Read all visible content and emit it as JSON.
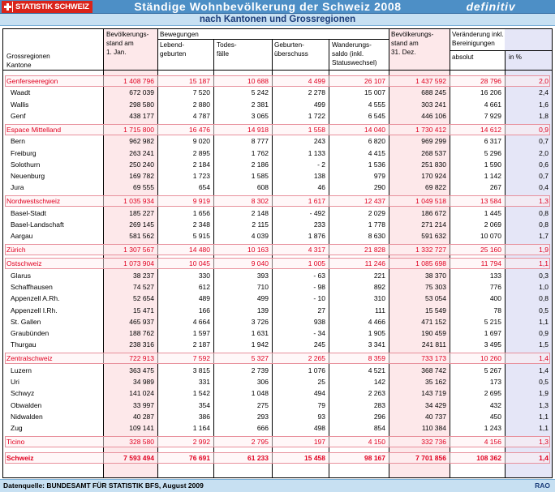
{
  "header": {
    "logo_text": "STATISTIK SCHWEIZ",
    "title": "Ständige Wohnbevölkerung der Schweiz 2008",
    "status": "definitiv",
    "subtitle": "nach Kantonen und Grossregionen"
  },
  "table": {
    "col_headers": {
      "name_1": "Grossregionen",
      "name_2": "Kantone",
      "pop_start_1": "Bevölkerungs-",
      "pop_start_2": "stand am",
      "pop_start_3": "1. Jan.",
      "movements": "Bewegungen",
      "births_1": "Lebend-",
      "births_2": "geburten",
      "deaths_1": "Todes-",
      "deaths_2": "fälle",
      "surplus_1": "Geburten-",
      "surplus_2": "überschuss",
      "migration_1": "Wanderungs-",
      "migration_2": "saldo (inkl.",
      "migration_3": "Statuswechsel)",
      "pop_end_1": "Bevölkerungs-",
      "pop_end_2": "stand am",
      "pop_end_3": "31. Dez.",
      "change_1": "Veränderung inkl.",
      "change_2": "Bereinigungen",
      "absolute": "absolut",
      "percent": "in %"
    },
    "rows": [
      {
        "type": "region",
        "name": "Genferseeregion",
        "start": "1 408 796",
        "births": "15 187",
        "deaths": "10 688",
        "surplus": "4 499",
        "migration": "26 107",
        "end": "1 437 592",
        "abs": "28 796",
        "pct": "2,0"
      },
      {
        "type": "canton",
        "name": "Waadt",
        "start": "672 039",
        "births": "7 520",
        "deaths": "5 242",
        "surplus": "2 278",
        "migration": "15 007",
        "end": "688 245",
        "abs": "16 206",
        "pct": "2,4"
      },
      {
        "type": "canton",
        "name": "Wallis",
        "start": "298 580",
        "births": "2 880",
        "deaths": "2 381",
        "surplus": "499",
        "migration": "4 555",
        "end": "303 241",
        "abs": "4 661",
        "pct": "1,6"
      },
      {
        "type": "canton",
        "name": "Genf",
        "start": "438 177",
        "births": "4 787",
        "deaths": "3 065",
        "surplus": "1 722",
        "migration": "6 545",
        "end": "446 106",
        "abs": "7 929",
        "pct": "1,8"
      },
      {
        "type": "region",
        "name": "Espace Mittelland",
        "start": "1 715 800",
        "births": "16 476",
        "deaths": "14 918",
        "surplus": "1 558",
        "migration": "14 040",
        "end": "1 730 412",
        "abs": "14 612",
        "pct": "0,9"
      },
      {
        "type": "canton",
        "name": "Bern",
        "start": "962 982",
        "births": "9 020",
        "deaths": "8 777",
        "surplus": "243",
        "migration": "6 820",
        "end": "969 299",
        "abs": "6 317",
        "pct": "0,7"
      },
      {
        "type": "canton",
        "name": "Freiburg",
        "start": "263 241",
        "births": "2 895",
        "deaths": "1 762",
        "surplus": "1 133",
        "migration": "4 415",
        "end": "268 537",
        "abs": "5 296",
        "pct": "2,0"
      },
      {
        "type": "canton",
        "name": "Solothurn",
        "start": "250 240",
        "births": "2 184",
        "deaths": "2 186",
        "surplus": "- 2",
        "migration": "1 536",
        "end": "251 830",
        "abs": "1 590",
        "pct": "0,6"
      },
      {
        "type": "canton",
        "name": "Neuenburg",
        "start": "169 782",
        "births": "1 723",
        "deaths": "1 585",
        "surplus": "138",
        "migration": "979",
        "end": "170 924",
        "abs": "1 142",
        "pct": "0,7"
      },
      {
        "type": "canton",
        "name": "Jura",
        "start": "69 555",
        "births": "654",
        "deaths": "608",
        "surplus": "46",
        "migration": "290",
        "end": "69 822",
        "abs": "267",
        "pct": "0,4"
      },
      {
        "type": "region",
        "name": "Nordwestschweiz",
        "start": "1 035 934",
        "births": "9 919",
        "deaths": "8 302",
        "surplus": "1 617",
        "migration": "12 437",
        "end": "1 049 518",
        "abs": "13 584",
        "pct": "1,3"
      },
      {
        "type": "canton",
        "name": "Basel-Stadt",
        "start": "185 227",
        "births": "1 656",
        "deaths": "2 148",
        "surplus": "- 492",
        "migration": "2 029",
        "end": "186 672",
        "abs": "1 445",
        "pct": "0,8"
      },
      {
        "type": "canton",
        "name": "Basel-Landschaft",
        "start": "269 145",
        "births": "2 348",
        "deaths": "2 115",
        "surplus": "233",
        "migration": "1 778",
        "end": "271 214",
        "abs": "2 069",
        "pct": "0,8"
      },
      {
        "type": "canton",
        "name": "Aargau",
        "start": "581 562",
        "births": "5 915",
        "deaths": "4 039",
        "surplus": "1 876",
        "migration": "8 630",
        "end": "591 632",
        "abs": "10 070",
        "pct": "1,7"
      },
      {
        "type": "region",
        "name": "Zürich",
        "start": "1 307 567",
        "births": "14 480",
        "deaths": "10 163",
        "surplus": "4 317",
        "migration": "21 828",
        "end": "1 332 727",
        "abs": "25 160",
        "pct": "1,9"
      },
      {
        "type": "region",
        "name": "Ostschweiz",
        "start": "1 073 904",
        "births": "10 045",
        "deaths": "9 040",
        "surplus": "1 005",
        "migration": "11 246",
        "end": "1 085 698",
        "abs": "11 794",
        "pct": "1,1"
      },
      {
        "type": "canton",
        "name": "Glarus",
        "start": "38 237",
        "births": "330",
        "deaths": "393",
        "surplus": "- 63",
        "migration": "221",
        "end": "38 370",
        "abs": "133",
        "pct": "0,3"
      },
      {
        "type": "canton",
        "name": "Schaffhausen",
        "start": "74 527",
        "births": "612",
        "deaths": "710",
        "surplus": "- 98",
        "migration": "892",
        "end": "75 303",
        "abs": "776",
        "pct": "1,0"
      },
      {
        "type": "canton",
        "name": "Appenzell A.Rh.",
        "start": "52 654",
        "births": "489",
        "deaths": "499",
        "surplus": "- 10",
        "migration": "310",
        "end": "53 054",
        "abs": "400",
        "pct": "0,8"
      },
      {
        "type": "canton",
        "name": "Appenzell I.Rh.",
        "start": "15 471",
        "births": "166",
        "deaths": "139",
        "surplus": "27",
        "migration": "111",
        "end": "15 549",
        "abs": "78",
        "pct": "0,5"
      },
      {
        "type": "canton",
        "name": "St. Gallen",
        "start": "465 937",
        "births": "4 664",
        "deaths": "3 726",
        "surplus": "938",
        "migration": "4 466",
        "end": "471 152",
        "abs": "5 215",
        "pct": "1,1"
      },
      {
        "type": "canton",
        "name": "Graubünden",
        "start": "188 762",
        "births": "1 597",
        "deaths": "1 631",
        "surplus": "- 34",
        "migration": "1 905",
        "end": "190 459",
        "abs": "1 697",
        "pct": "0,9"
      },
      {
        "type": "canton",
        "name": "Thurgau",
        "start": "238 316",
        "births": "2 187",
        "deaths": "1 942",
        "surplus": "245",
        "migration": "3 341",
        "end": "241 811",
        "abs": "3 495",
        "pct": "1,5"
      },
      {
        "type": "region",
        "name": "Zentralschweiz",
        "start": "722 913",
        "births": "7 592",
        "deaths": "5 327",
        "surplus": "2 265",
        "migration": "8 359",
        "end": "733 173",
        "abs": "10 260",
        "pct": "1,4"
      },
      {
        "type": "canton",
        "name": "Luzern",
        "start": "363 475",
        "births": "3 815",
        "deaths": "2 739",
        "surplus": "1 076",
        "migration": "4 521",
        "end": "368 742",
        "abs": "5 267",
        "pct": "1,4"
      },
      {
        "type": "canton",
        "name": "Uri",
        "start": "34 989",
        "births": "331",
        "deaths": "306",
        "surplus": "25",
        "migration": "142",
        "end": "35 162",
        "abs": "173",
        "pct": "0,5"
      },
      {
        "type": "canton",
        "name": "Schwyz",
        "start": "141 024",
        "births": "1 542",
        "deaths": "1 048",
        "surplus": "494",
        "migration": "2 263",
        "end": "143 719",
        "abs": "2 695",
        "pct": "1,9"
      },
      {
        "type": "canton",
        "name": "Obwalden",
        "start": "33 997",
        "births": "354",
        "deaths": "275",
        "surplus": "79",
        "migration": "283",
        "end": "34 429",
        "abs": "432",
        "pct": "1,3"
      },
      {
        "type": "canton",
        "name": "Nidwalden",
        "start": "40 287",
        "births": "386",
        "deaths": "293",
        "surplus": "93",
        "migration": "296",
        "end": "40 737",
        "abs": "450",
        "pct": "1,1"
      },
      {
        "type": "canton",
        "name": "Zug",
        "start": "109 141",
        "births": "1 164",
        "deaths": "666",
        "surplus": "498",
        "migration": "854",
        "end": "110 384",
        "abs": "1 243",
        "pct": "1,1"
      },
      {
        "type": "region",
        "name": "Ticino",
        "start": "328 580",
        "births": "2 992",
        "deaths": "2 795",
        "surplus": "197",
        "migration": "4 150",
        "end": "332 736",
        "abs": "4 156",
        "pct": "1,3"
      },
      {
        "type": "total",
        "name": "Schweiz",
        "start": "7 593 494",
        "births": "76 691",
        "deaths": "61 233",
        "surplus": "15 458",
        "migration": "98 167",
        "end": "7 701 856",
        "abs": "108 362",
        "pct": "1,4"
      }
    ]
  },
  "footer": {
    "source": "Datenquelle: BUNDESAMT FÜR STATISTIK BFS, August  2009",
    "code": "RAO"
  },
  "colors": {
    "header_blue": "#4d8fc6",
    "subtitle_band": "#c7e0f2",
    "region_red": "#e00020",
    "pink_column": "#fde8ea",
    "lavender_column": "#e5e6f7"
  }
}
